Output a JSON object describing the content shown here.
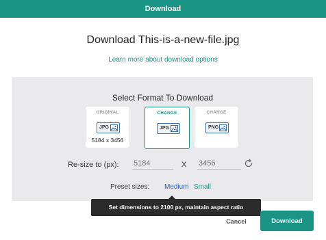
{
  "header": {
    "title": "Download"
  },
  "dialog": {
    "file_title": "Download This-is-a-new-file.jpg",
    "learn_more": "Learn more about download options"
  },
  "format": {
    "section_title": "Select Format To Download",
    "cards": [
      {
        "label": "ORIGINAL",
        "format": "JPG",
        "dimensions": "5184 x 3456",
        "selected": false
      },
      {
        "label": "CHANGE",
        "format": "JPG",
        "selected": true
      },
      {
        "label": "CHANGE",
        "format": "PNG",
        "selected": false
      }
    ]
  },
  "resize": {
    "label": "Re-size to (px):",
    "width_placeholder": "5184",
    "separator": "X",
    "height_placeholder": "3456"
  },
  "preset": {
    "label": "Preset sizes:",
    "medium": "Medium",
    "small": "Small"
  },
  "tooltip": {
    "text": "Set dimensions to 2100 px, maintain aspect ratio"
  },
  "actions": {
    "cancel": "Cancel",
    "download": "Download"
  },
  "colors": {
    "accent": "#1a9585",
    "link_blue": "#2a5db0",
    "panel_bg": "#eaeaec",
    "tooltip_bg": "#2b2b2b"
  }
}
